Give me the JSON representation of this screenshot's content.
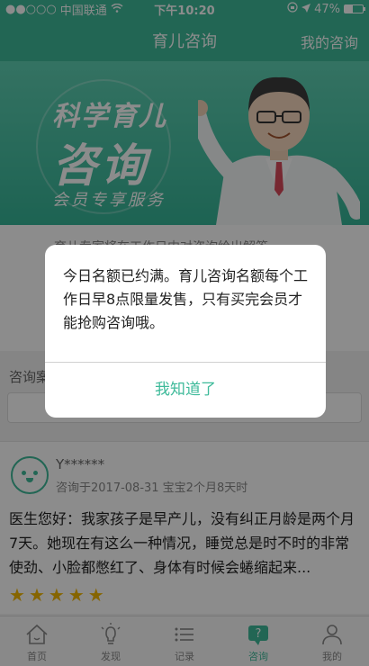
{
  "status_bar": {
    "carrier": "中国联通",
    "time": "下午10:20",
    "battery": "47%",
    "battery_level": 0.47
  },
  "navbar": {
    "title": "育儿咨询",
    "right_link": "我的咨询"
  },
  "banner": {
    "line1": "科学育儿",
    "line2": "咨询",
    "line3": "会员专享服务"
  },
  "description": "育儿专家将在工作日内对咨询给出解答",
  "search": {
    "label": "咨询案"
  },
  "card": {
    "user": "Y******",
    "meta": "咨询于2017-08-31 宝宝2个月8天时",
    "question": "医生您好：我家孩子是早产儿，没有纠正月龄是两个月7天。她现在有这么一种情况，睡觉总是时不时的非常使劲、小脸都憋红了、身体有时候会蜷缩起来...",
    "rating": 5
  },
  "tabs": [
    {
      "label": "首页",
      "icon": "home-icon"
    },
    {
      "label": "发现",
      "icon": "lightbulb-icon"
    },
    {
      "label": "记录",
      "icon": "list-icon"
    },
    {
      "label": "咨询",
      "icon": "question-icon",
      "active": true
    },
    {
      "label": "我的",
      "icon": "user-icon"
    }
  ],
  "dialog": {
    "message": "今日名额已约满。育儿咨询名额每个工作日早8点限量发售，只有买完会员才能抢购咨询哦。",
    "button": "我知道了"
  },
  "colors": {
    "brand": "#3eba9a",
    "star": "#f5b800"
  }
}
